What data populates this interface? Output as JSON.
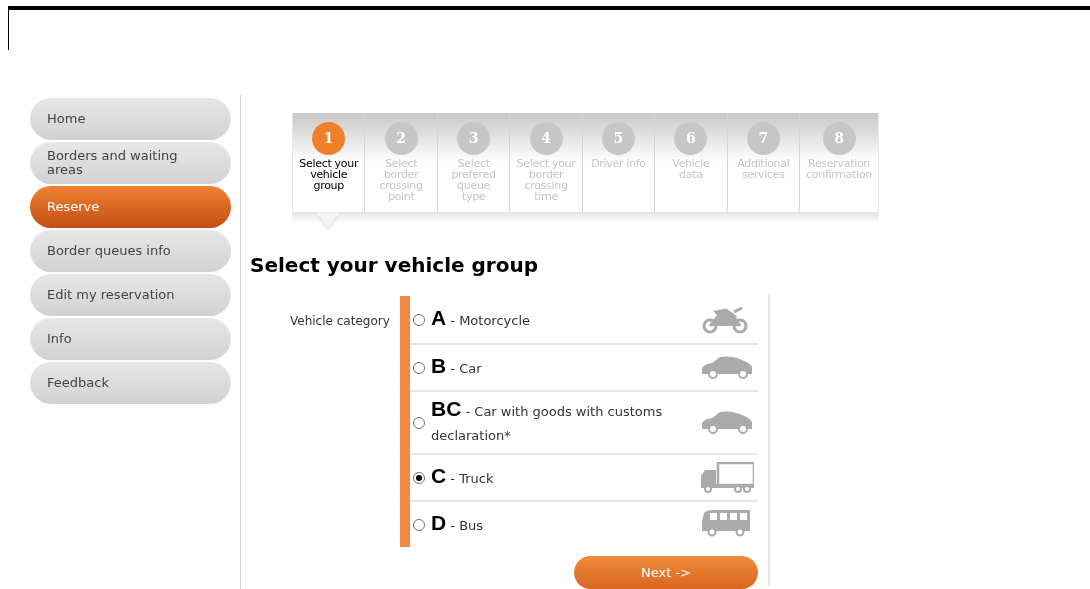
{
  "sidebar": {
    "items": [
      {
        "label": "Home",
        "selected": false
      },
      {
        "label": "Borders and waiting areas",
        "selected": false
      },
      {
        "label": "Reserve",
        "selected": true
      },
      {
        "label": "Border queues info",
        "selected": false
      },
      {
        "label": "Edit my reservation",
        "selected": false
      },
      {
        "label": "Info",
        "selected": false
      },
      {
        "label": "Feedback",
        "selected": false
      }
    ]
  },
  "steps": [
    {
      "number": "1",
      "label": "Select your vehicle group",
      "selected": true
    },
    {
      "number": "2",
      "label": "Select border crossing point",
      "selected": false
    },
    {
      "number": "3",
      "label": "Select prefered queue type",
      "selected": false
    },
    {
      "number": "4",
      "label": "Select your border crossing time",
      "selected": false
    },
    {
      "number": "5",
      "label": "Driver info",
      "selected": false
    },
    {
      "number": "6",
      "label": "Vehicle data",
      "selected": false
    },
    {
      "number": "7",
      "label": "Additional services",
      "selected": false
    },
    {
      "number": "8",
      "label": "Reservation confirmation",
      "selected": false
    }
  ],
  "heading": "Select your vehicle group",
  "form": {
    "label": "Vehicle category",
    "options": [
      {
        "code": "A",
        "text": "- Motorcycle",
        "kind": "motorcycle",
        "selected": false
      },
      {
        "code": "B",
        "text": "- Car",
        "kind": "car",
        "selected": false
      },
      {
        "code": "BC",
        "text": "- Car with goods with customs declaration*",
        "kind": "car",
        "selected": false
      },
      {
        "code": "C",
        "text": "- Truck",
        "kind": "truck",
        "selected": true
      },
      {
        "code": "D",
        "text": "- Bus",
        "kind": "bus",
        "selected": false
      }
    ]
  },
  "next_button": "Next ->"
}
